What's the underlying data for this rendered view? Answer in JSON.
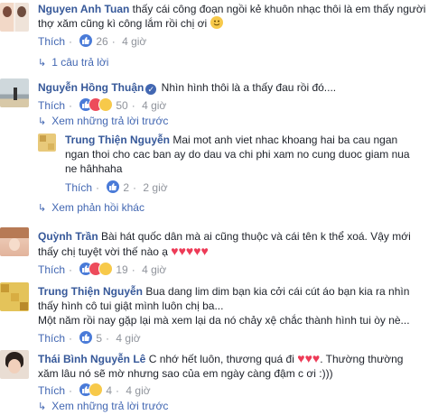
{
  "comments": [
    {
      "name": "Nguyen Anh Tuan",
      "text": "thấy cái công đoạn ngồi kẻ khuôn nhạc thôi là em thấy người thợ xăm cũng kì công lắm rồi chị ơi",
      "like_label": "Thích",
      "reaction_count": "26",
      "time": "4 giờ",
      "replies_label": "1 câu trả lời"
    },
    {
      "name": "Nguyễn Hồng Thuận",
      "text": "Nhìn hình thôi là a thấy đau rồi đó....",
      "like_label": "Thích",
      "reaction_count": "50",
      "time": "4 giờ",
      "more_replies_label": "Xem những trả lời trước",
      "reply": {
        "name": "Trung Thiện Nguyễn",
        "text": "Mai mot anh viet nhac khoang hai ba cau ngan ngan thoi cho cac ban ay do dau va chi phi xam no cung duoc giam nua ne hâhhaha",
        "like_label": "Thích",
        "reaction_count": "2",
        "time": "2 giờ"
      },
      "other_feedback_label": "Xem phản hồi khác"
    },
    {
      "name": "Quỳnh Trần",
      "text": "Bài hát quốc dân mà ai cũng thuộc và cái tên k thể xoá. Vậy mới thấy chị tuyệt vời thế nào ạ",
      "like_label": "Thích",
      "reaction_count": "19",
      "time": "4 giờ"
    },
    {
      "name": "Trung Thiện Nguyễn",
      "text": "Bua dang lim dim bạn kia cởi cái cút áo bạn kia ra nhìn thấy hình cô tui giật mình luôn chị ba...",
      "text2": "Một năm rồi nay gặp lại mà xem lại da nó chảy xệ chắc thành hình tui òy nè...",
      "like_label": "Thích",
      "reaction_count": "5",
      "time": "4 giờ"
    },
    {
      "name": "Thái Bình Nguyễn Lê",
      "text": "C nhớ hết luôn, thương quá đi",
      "text_after": ". Thường thường xăm lâu nó sẽ mờ nhưng sao của em ngày càng đậm c ơi :)))",
      "like_label": "Thích",
      "reaction_count": "4",
      "time": "4 giờ",
      "more_replies_label": "Xem những trả lời trước"
    }
  ],
  "colors": {
    "link": "#365899",
    "meta": "#90949c",
    "heart": "#ed3b57",
    "like": "#4a7bd8"
  }
}
